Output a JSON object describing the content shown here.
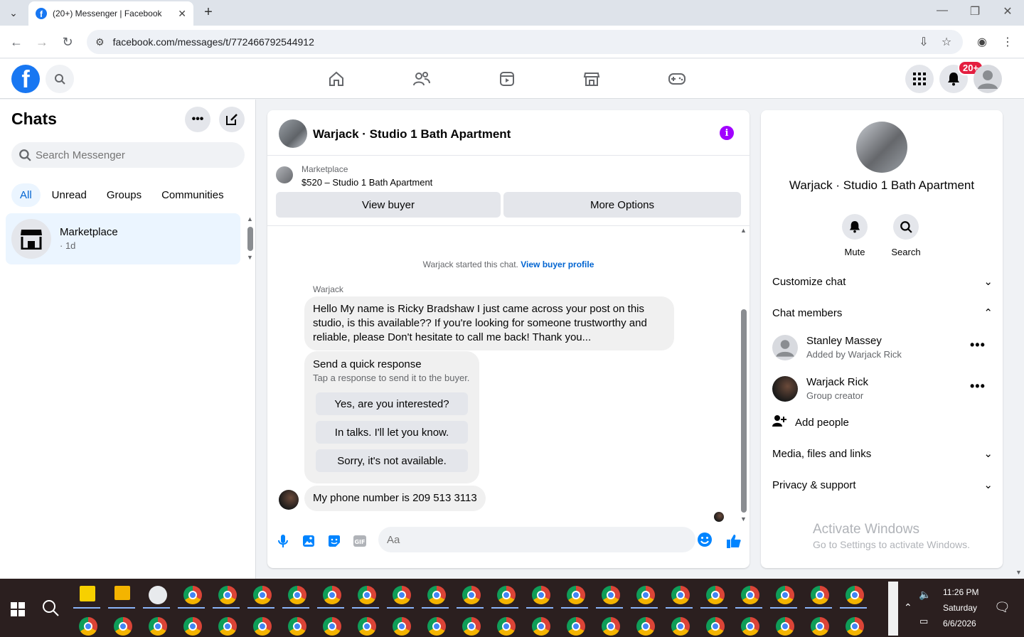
{
  "browser": {
    "tab_title": "(20+) Messenger | Facebook",
    "url": "facebook.com/messages/t/772466792544912"
  },
  "fbnav": {
    "notifications_badge": "20+"
  },
  "chats": {
    "title": "Chats",
    "search_placeholder": "Search Messenger",
    "filters": [
      "All",
      "Unread",
      "Groups",
      "Communities"
    ],
    "active_filter": "All",
    "items": [
      {
        "name": "Marketplace",
        "time": "· 1d"
      }
    ]
  },
  "conversation": {
    "title": "Warjack · Studio 1 Bath Apartment",
    "marketplace_label": "Marketplace",
    "listing": "$520 – Studio 1 Bath Apartment",
    "view_buyer": "View buyer",
    "more_options": "More Options",
    "started_text": "Warjack started this chat.",
    "started_link": "View buyer profile",
    "sender": "Warjack",
    "message1_lines": [
      "Hello My name is Ricky Bradshaw I just came across your post on this",
      "studio, is this available?? If you're looking for someone trustworthy and",
      "reliable, please Don't hesitate to call me back! Thank you..."
    ],
    "quick_response": {
      "heading": "Send a quick response",
      "sub": "Tap a response to send it to the buyer.",
      "options": [
        "Yes, are you interested?",
        "In talks. I'll let you know.",
        "Sorry, it's not available."
      ]
    },
    "message2": "My phone number is 209 513 3113",
    "composer_placeholder": "Aa"
  },
  "details": {
    "name": "Warjack · Studio 1 Bath Apartment",
    "actions": [
      "Mute",
      "Search"
    ],
    "sections": {
      "customize": "Customize chat",
      "members": "Chat members",
      "add_people": "Add people",
      "media": "Media, files and links",
      "privacy": "Privacy & support"
    },
    "members": [
      {
        "name": "Stanley Massey",
        "sub": "Added by Warjack Rick"
      },
      {
        "name": "Warjack Rick",
        "sub": "Group creator"
      }
    ]
  },
  "watermark": {
    "line1": "Activate Windows",
    "line2": "Go to Settings to activate Windows."
  },
  "taskbar": {
    "time": "11:26 PM",
    "day": "Saturday",
    "date": "6/6/2026"
  },
  "colors": {
    "fb_blue": "#1877f2",
    "link_blue": "#0064d1",
    "badge_red": "#e41e3f",
    "info_purple": "#a100ff"
  }
}
